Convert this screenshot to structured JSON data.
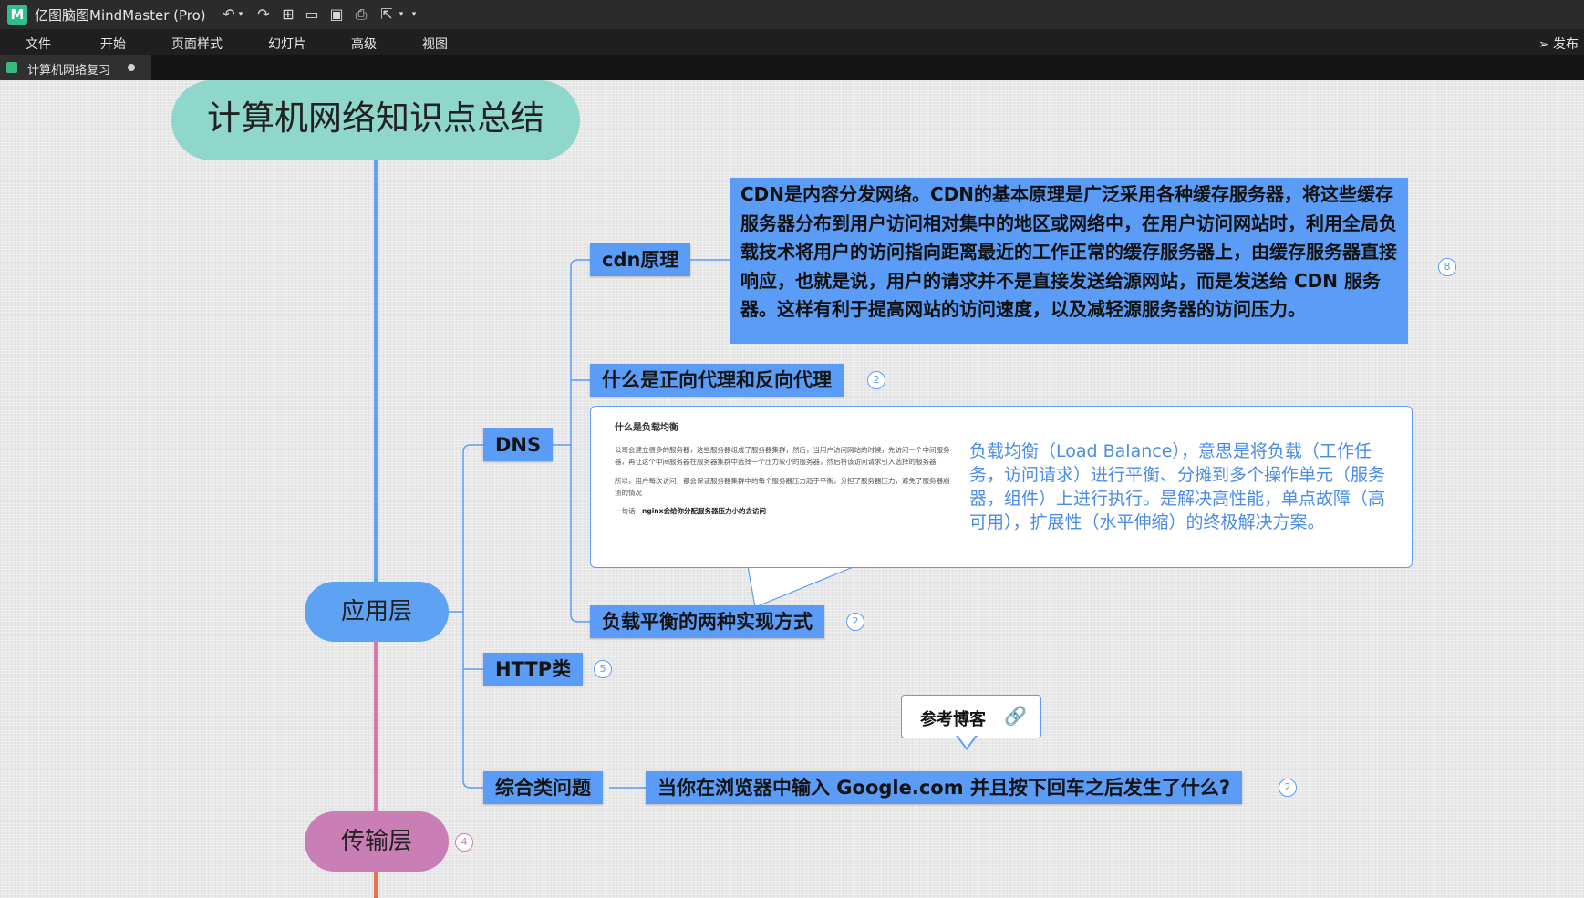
{
  "app": {
    "title": "亿图脑图MindMaster (Pro)",
    "logo": "M"
  },
  "menu": {
    "items": [
      "文件",
      "开始",
      "页面样式",
      "幻灯片",
      "高级",
      "视图"
    ],
    "publish": "发布"
  },
  "tabs": [
    {
      "label": "计算机网络复习",
      "unsaved": true
    }
  ],
  "colors": {
    "root": "#8fd6cb",
    "app_layer": "#5ea2f4",
    "transport_layer": "#c97fb6",
    "topic": "#5b9cf6",
    "callout_text": "#4a8ce6"
  },
  "map": {
    "root": "计算机网络知识点总结",
    "app_layer": "应用层",
    "transport_layer": "传输层",
    "transport_count": "4",
    "dns": "DNS",
    "http": "HTTP类",
    "http_count": "5",
    "general": "综合类问题",
    "cdn": "cdn原理",
    "cdn_count": "8",
    "cdn_note": "CDN是内容分发网络。CDN的基本原理是广泛采用各种缓存服务器，将这些缓存服务器分布到用户访问相对集中的地区或网络中，在用户访问网站时，利用全局负载技术将用户的访问指向距离最近的工作正常的缓存服务器上，由缓存服务器直接响应，也就是说，用户的请求并不是直接发送给源网站，而是发送给 CDN 服务器。这样有利于提高网站的访问速度，以及减轻源服务器的访问压力。",
    "proxy": "什么是正向代理和反向代理",
    "proxy_count": "2",
    "lb": "负载平衡的两种实现方式",
    "lb_count": "2",
    "lb_callout": {
      "shot_title": "什么是负载均衡",
      "shot_p1": "公司会建立很多的服务器，这些服务器组成了服务器集群，然后，当用户访问网站的时候，先访问一个中间服务器，再让这个中间服务器在服务器集群中选择一个压力较小的服务器，然后将该访问请求引入选择的服务器",
      "shot_p2": "所以，用户每次访问，都会保证服务器集群中的每个服务器压力趋于平衡，分担了服务器压力，避免了服务器崩溃的情况",
      "shot_last_prefix": "一句话：",
      "shot_last_bold": "nginx会给你分配服务器压力小的去访问",
      "text": "负载均衡（Load Balance），意思是将负载（工作任务，访问请求）进行平衡、分摊到多个操作单元（服务器，组件）上进行执行。是解决高性能，单点故障（高可用），扩展性（水平伸缩）的终极解决方案。"
    },
    "google": "当你在浏览器中输入 Google.com 并且按下回车之后发生了什么?",
    "google_count": "2",
    "ref_label": "参考博客"
  }
}
